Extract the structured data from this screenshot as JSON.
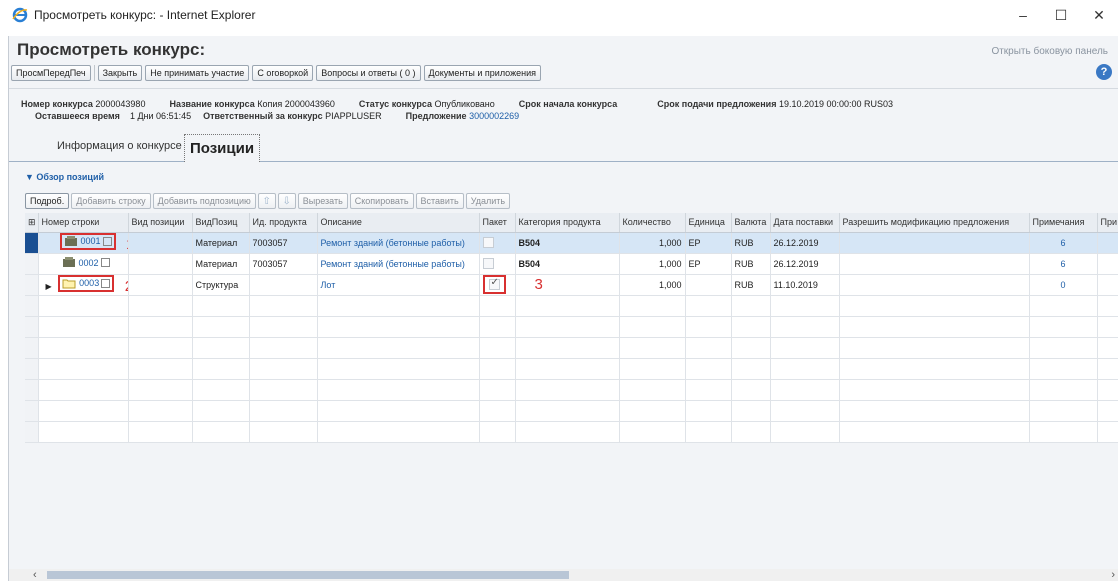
{
  "window": {
    "title": "Просмотреть конкурс: - Internet Explorer",
    "minimize": "–",
    "maximize": "☐",
    "close": "✕"
  },
  "page": {
    "title": "Просмотреть конкурс:",
    "sidebar_link": "Открыть боковую панель"
  },
  "toolbar": {
    "buttons": [
      "ПросмПередПеч",
      "Закрыть",
      "Не принимать участие",
      "С оговоркой",
      "Вопросы и ответы ( 0 )",
      "Документы и приложения"
    ]
  },
  "info": {
    "row1": [
      {
        "label": "Номер конкурса",
        "value": "2000043980"
      },
      {
        "label": "Название конкурса",
        "value": "Копия 2000043960"
      },
      {
        "label": "Статус конкурса",
        "value": "Опубликовано"
      },
      {
        "label": "Срок начала конкурса",
        "value": ""
      },
      {
        "label": "Срок подачи предложения",
        "value": "19.10.2019 00:00:00 RUS03"
      }
    ],
    "row2": [
      {
        "label": "Оставшееся время",
        "value": "1 Дни 06:51:45"
      },
      {
        "label": "Ответственный за конкурс",
        "value": "PIAPPLUSER"
      },
      {
        "label": "Предложение",
        "value": "3000002269"
      }
    ]
  },
  "tabs": [
    "Информация о конкурсе",
    "Позиции"
  ],
  "section": {
    "title": "▼ Обзор позиций"
  },
  "grid_toolbar": {
    "buttons": [
      "Подроб.",
      "Добавить строку",
      "Добавить подпозицию",
      "Вырезать",
      "Скопировать",
      "Вставить",
      "Удалить"
    ]
  },
  "grid": {
    "columns": [
      "Номер строки",
      "Вид позиции",
      "ВидПозиц",
      "Ид. продукта",
      "Описание",
      "Пакет",
      "Категория продукта",
      "Количество",
      "Единица",
      "Валюта",
      "Дата поставки",
      "Разрешить модификацию предложения",
      "Примечания",
      "При"
    ],
    "rows": [
      {
        "line": "0001",
        "type": "",
        "type2": "Материал",
        "product": "7003057",
        "desc": "Ремонт зданий (бетонные работы)",
        "package": false,
        "category": "B504",
        "qty": "1,000",
        "unit": "EP",
        "currency": "RUB",
        "date": "26.12.2019",
        "modif": "",
        "notes": "6",
        "mark": "1"
      },
      {
        "line": "0002",
        "type": "",
        "type2": "Материал",
        "product": "7003057",
        "desc": "Ремонт зданий (бетонные работы)",
        "package": false,
        "category": "B504",
        "qty": "1,000",
        "unit": "EP",
        "currency": "RUB",
        "date": "26.12.2019",
        "modif": "",
        "notes": "6",
        "mark": ""
      },
      {
        "line": "0003",
        "type": "",
        "type2": "Структура",
        "product": "",
        "desc": "Лот",
        "package": true,
        "category": "",
        "qty": "1,000",
        "unit": "",
        "currency": "RUB",
        "date": "11.10.2019",
        "modif": "",
        "notes": "0",
        "mark": "2",
        "pkg_mark": "3"
      }
    ]
  }
}
